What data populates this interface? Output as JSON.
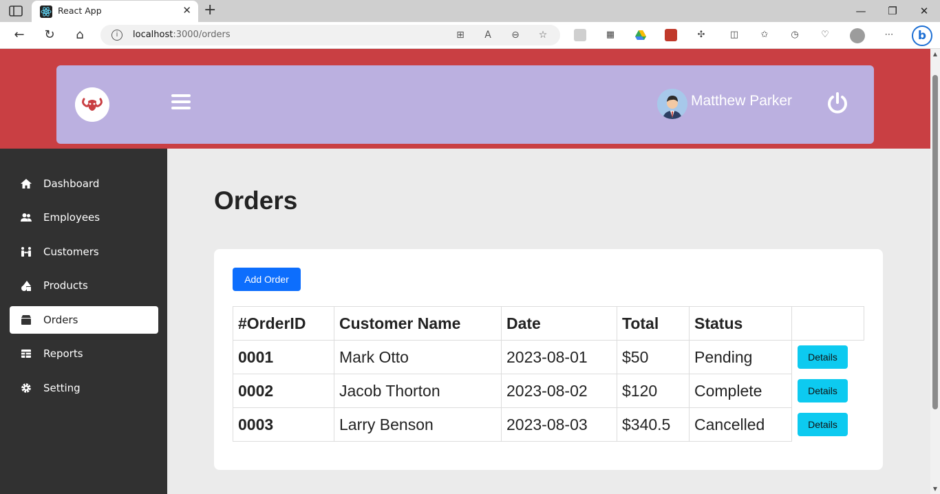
{
  "browser": {
    "tab_title": "React App",
    "url_host": "localhost",
    "url_path": ":3000/orders",
    "close_tab": "✕",
    "new_tab": "+",
    "minimize": "—",
    "restore": "❐",
    "close_window": "✕"
  },
  "header": {
    "user_name": "Matthew Parker"
  },
  "sidebar": {
    "items": [
      {
        "label": "Dashboard",
        "icon": "home-icon",
        "active": false
      },
      {
        "label": "Employees",
        "icon": "users-icon",
        "active": false
      },
      {
        "label": "Customers",
        "icon": "people-arrows-icon",
        "active": false
      },
      {
        "label": "Products",
        "icon": "shapes-icon",
        "active": false
      },
      {
        "label": "Orders",
        "icon": "box-icon",
        "active": true
      },
      {
        "label": "Reports",
        "icon": "table-icon",
        "active": false
      },
      {
        "label": "Setting",
        "icon": "gear-icon",
        "active": false
      }
    ]
  },
  "main": {
    "title": "Orders",
    "add_button": "Add Order",
    "table": {
      "headers": [
        "#OrderID",
        "Customer Name",
        "Date",
        "Total",
        "Status"
      ],
      "rows": [
        {
          "id": "0001",
          "customer": "Mark Otto",
          "date": "2023-08-01",
          "total": "$50",
          "status": "Pending",
          "action": "Details"
        },
        {
          "id": "0002",
          "customer": "Jacob Thorton",
          "date": "2023-08-02",
          "total": "$120",
          "status": "Complete",
          "action": "Details"
        },
        {
          "id": "0003",
          "customer": "Larry Benson",
          "date": "2023-08-03",
          "total": "$340.5",
          "status": "Cancelled",
          "action": "Details"
        }
      ]
    }
  },
  "colors": {
    "header_band": "#c93f43",
    "header_card": "#bbb0e0",
    "sidebar": "#313131",
    "primary_button": "#0d6efd",
    "info_button": "#0dcaf0"
  }
}
